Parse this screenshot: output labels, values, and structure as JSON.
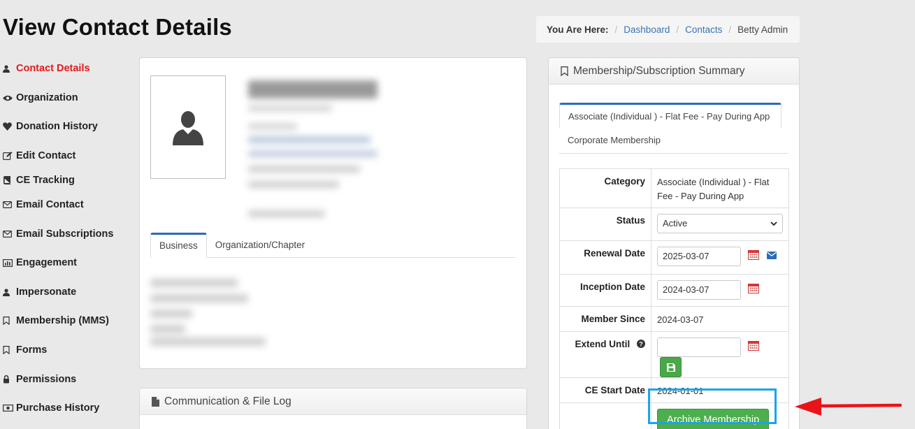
{
  "page": {
    "title": "View Contact Details"
  },
  "breadcrumb": {
    "label": "You Are Here:",
    "items": [
      "Dashboard",
      "Contacts"
    ],
    "current": "Betty Admin"
  },
  "sidebar": {
    "items": [
      {
        "label": "Contact Details",
        "icon": "user-icon",
        "active": true
      },
      {
        "label": "Organization",
        "icon": "eye-icon"
      },
      {
        "label": "Donation History",
        "icon": "heart-icon"
      },
      {
        "label": "Edit Contact",
        "icon": "edit-icon"
      },
      {
        "label": "CE Tracking",
        "icon": "book-icon"
      },
      {
        "label": "Email Contact",
        "icon": "envelope-icon"
      },
      {
        "label": "Email Subscriptions",
        "icon": "envelope-icon"
      },
      {
        "label": "Engagement",
        "icon": "bar-chart-icon"
      },
      {
        "label": "Impersonate",
        "icon": "user-icon"
      },
      {
        "label": "Membership (MMS)",
        "icon": "bookmark-icon"
      },
      {
        "label": "Forms",
        "icon": "bookmark-icon"
      },
      {
        "label": "Permissions",
        "icon": "lock-icon"
      },
      {
        "label": "Purchase History",
        "icon": "money-icon"
      }
    ]
  },
  "profile": {
    "tabs": [
      "Business",
      "Organization/Chapter"
    ]
  },
  "comm_log": {
    "title": "Communication & File Log"
  },
  "membership": {
    "title": "Membership/Subscription Summary",
    "tabs": [
      "Associate (Individual ) - Flat Fee - Pay During App",
      "Corporate Membership"
    ],
    "fields": {
      "category_label": "Category",
      "category_value": "Associate (Individual ) - Flat Fee - Pay During App",
      "status_label": "Status",
      "status_value": "Active",
      "renewal_label": "Renewal Date",
      "renewal_value": "2025-03-07",
      "inception_label": "Inception Date",
      "inception_value": "2024-03-07",
      "member_since_label": "Member Since",
      "member_since_value": "2024-03-07",
      "extend_label": "Extend Until",
      "extend_value": "",
      "ce_start_label": "CE Start Date",
      "ce_start_value": "2024-01-01"
    },
    "archive_button": "Archive Membership"
  },
  "colors": {
    "accent": "#2a6db5",
    "active_nav": "#e01b1b",
    "success": "#4cae4c",
    "highlight": "#1aa3ec",
    "arrow": "#e8141a"
  }
}
